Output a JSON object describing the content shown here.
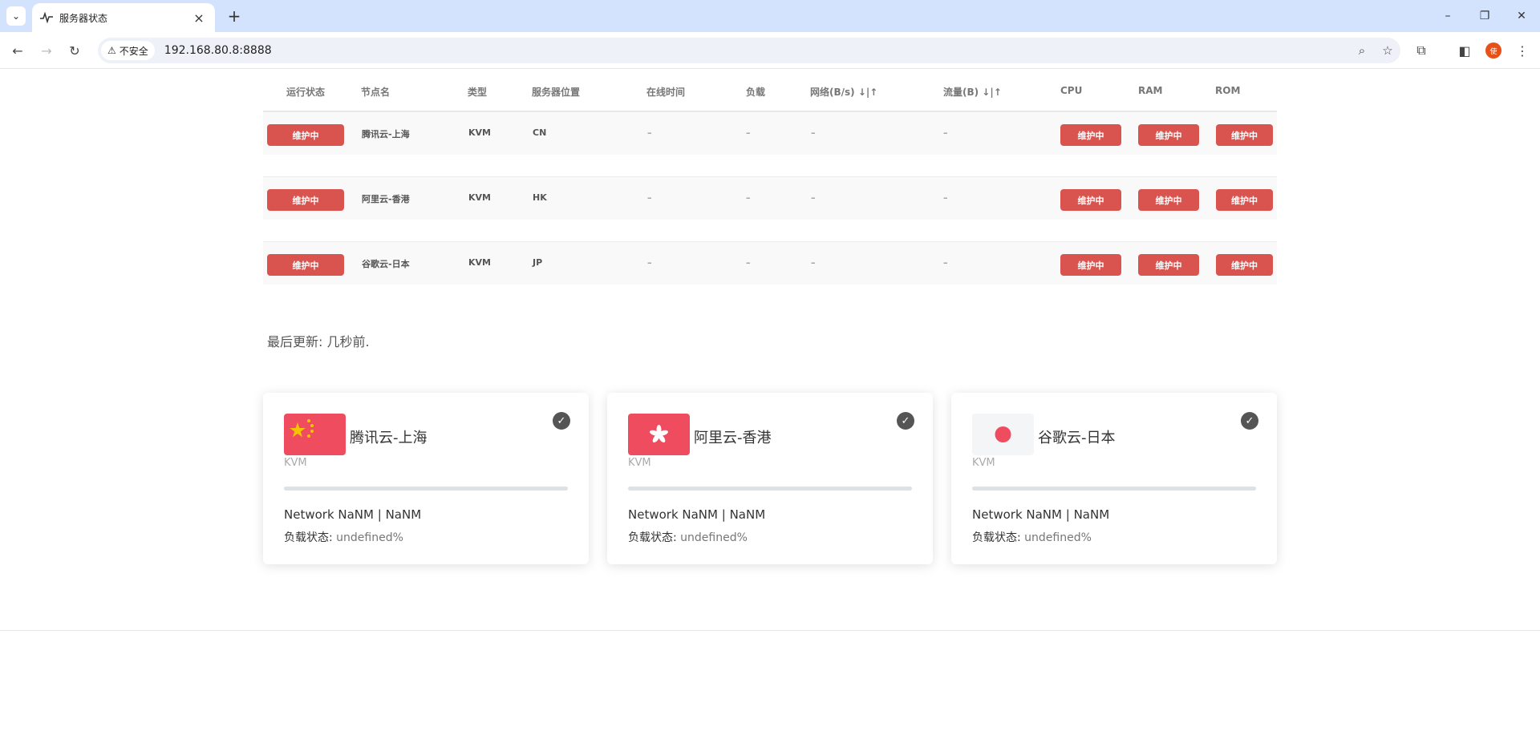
{
  "browser": {
    "tab_title": "服务器状态",
    "tab_close": "×",
    "new_tab": "+",
    "security_label": "不安全",
    "url": "192.168.80.8:8888",
    "profile_initial": "使",
    "window": {
      "minimize": "–",
      "restore": "❐",
      "close": "✕"
    }
  },
  "table": {
    "headers": [
      "运行状态",
      "节点名",
      "类型",
      "服务器位置",
      "在线时间",
      "负载",
      "网络(B/s) ↓|↑",
      "流量(B) ↓|↑",
      "CPU",
      "RAM",
      "ROM"
    ],
    "rows": [
      {
        "status": "维护中",
        "name": "腾讯云-上海",
        "type": "KVM",
        "location": "CN",
        "uptime": "–",
        "load": "–",
        "network": "–",
        "traffic": "–",
        "cpu": "维护中",
        "ram": "维护中",
        "rom": "维护中"
      },
      {
        "status": "维护中",
        "name": "阿里云-香港",
        "type": "KVM",
        "location": "HK",
        "uptime": "–",
        "load": "–",
        "network": "–",
        "traffic": "–",
        "cpu": "维护中",
        "ram": "维护中",
        "rom": "维护中"
      },
      {
        "status": "维护中",
        "name": "谷歌云-日本",
        "type": "KVM",
        "location": "JP",
        "uptime": "–",
        "load": "–",
        "network": "–",
        "traffic": "–",
        "cpu": "维护中",
        "ram": "维护中",
        "rom": "维护中"
      }
    ]
  },
  "last_updated": "最后更新: 几秒前.",
  "cards": [
    {
      "name": "腾讯云-上海",
      "type": "KVM",
      "flag": "cn-flag-icon",
      "network": "Network NaNM | NaNM",
      "load_label": "负载状态:",
      "load_value": "undefined%"
    },
    {
      "name": "阿里云-香港",
      "type": "KVM",
      "flag": "hk-flag-icon",
      "network": "Network NaNM | NaNM",
      "load_label": "负载状态:",
      "load_value": "undefined%"
    },
    {
      "name": "谷歌云-日本",
      "type": "KVM",
      "flag": "jp-flag-icon",
      "network": "Network NaNM | NaNM",
      "load_label": "负载状态:",
      "load_value": "undefined%"
    }
  ],
  "colors": {
    "maintenance": "#d9534f",
    "flag_red": "#ef4d5f",
    "chrome_tabbar": "#d3e3fd"
  }
}
